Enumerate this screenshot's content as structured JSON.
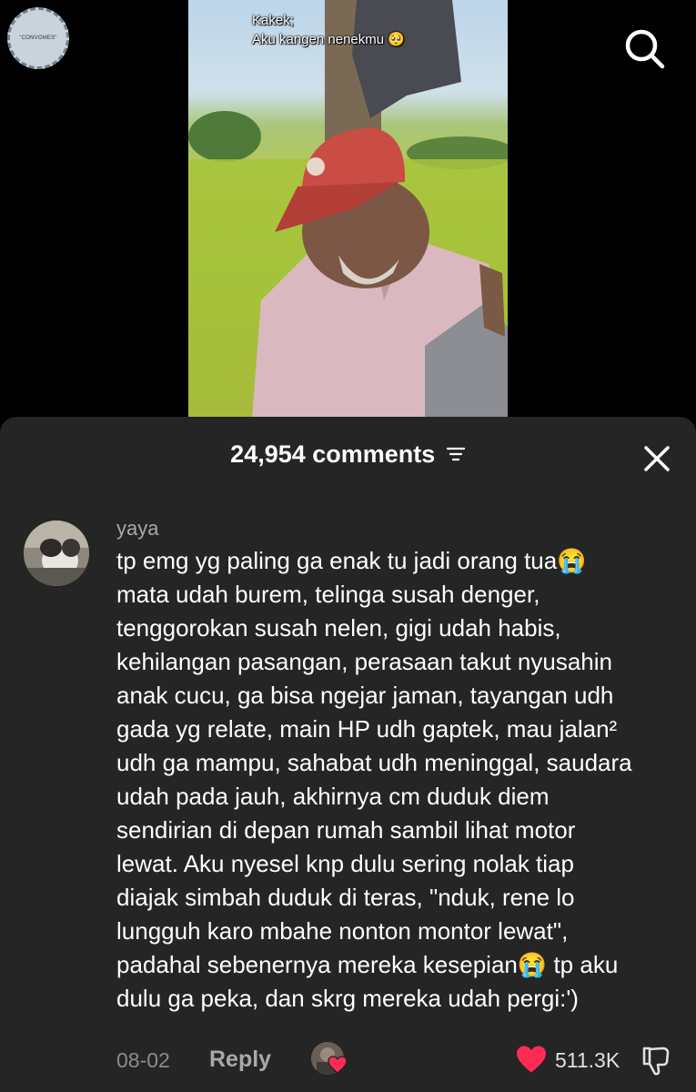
{
  "watermark": {
    "text": "\"CONVOMES\""
  },
  "video": {
    "caption_line1": "Kakek;",
    "caption_line2": "Aku kangen nenekmu 🥺"
  },
  "icons": {
    "search": "search-icon",
    "filter": "filter-icon",
    "close": "close-icon",
    "heart": "heart-icon",
    "dislike": "thumbs-down-icon"
  },
  "comments_sheet": {
    "title": "24,954 comments",
    "comment": {
      "username": "yaya",
      "text": "tp emg yg paling ga enak tu jadi orang tua😭\nmata udah burem, telinga susah denger,\ntenggorokan susah nelen, gigi udah habis,\nkehilangan pasangan, perasaan takut nyusahin\nanak cucu, ga bisa ngejar jaman, tayangan udh\ngada yg relate, main HP udh gaptek, mau jalan²\nudh ga mampu, sahabat udh meninggal, saudara\nudah pada jauh, akhirnya cm duduk diem\nsendirian di depan rumah sambil lihat motor\nlewat. Aku nyesel knp dulu sering nolak tiap\ndiajak simbah duduk di teras, \"nduk, rene lo\nlungguh karo mbahe nonton montor lewat\",\npadahal sebenernya mereka kesepian😭 tp aku\ndulu ga peka, dan skrg mereka udah pergi:')",
      "date": "08-02",
      "reply_label": "Reply",
      "like_count": "511.3K"
    }
  },
  "colors": {
    "background": "#000000",
    "sheet": "#252525",
    "like_red": "#fe2c55",
    "muted_text": "#a9a9a9"
  }
}
